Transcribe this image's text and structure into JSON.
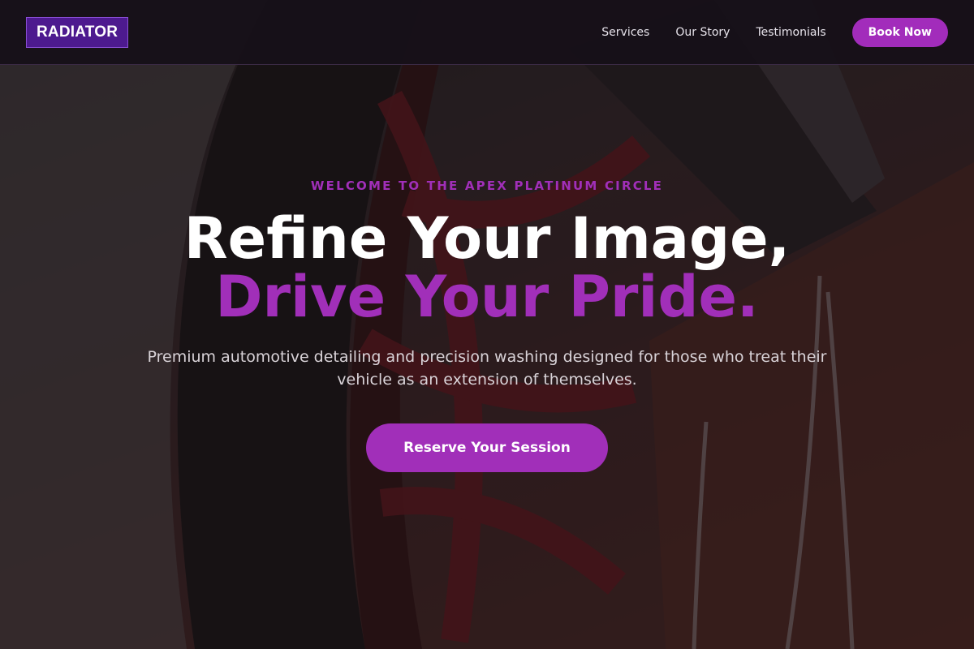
{
  "brand": {
    "logo": "RADIATOR"
  },
  "nav": {
    "links": [
      "Services",
      "Our Story",
      "Testimonials"
    ],
    "cta_label": "Book Now"
  },
  "hero": {
    "eyebrow": "WELCOME TO THE APEX PLATINUM CIRCLE",
    "headline_line1": "Refine Your Image,",
    "headline_line2": "Drive Your Pride.",
    "subtext": "Premium automotive detailing and precision washing designed for those who treat their vehicle as an extension of themselves.",
    "cta_label": "Reserve Your Session"
  },
  "colors": {
    "accent": "#a12fb9",
    "logo_bg": "#4d1a8f",
    "nav_bg": "#161018"
  }
}
